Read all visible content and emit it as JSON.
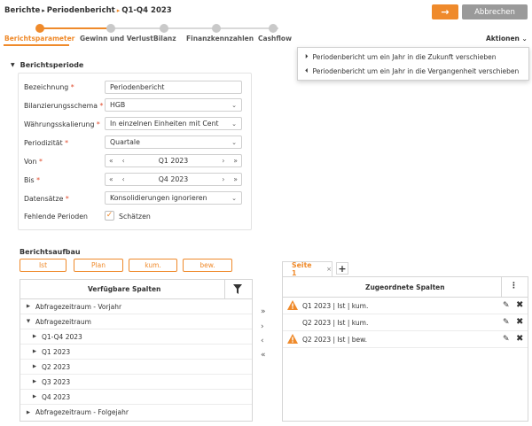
{
  "breadcrumb": {
    "items": [
      "Berichte",
      "Periodenbericht",
      "Q1-Q4 2023"
    ]
  },
  "header_buttons": {
    "next_label": "→",
    "cancel_label": "Abbrechen"
  },
  "steps": [
    {
      "label": "Berichtsparameter",
      "active": true
    },
    {
      "label": "Gewinn und Verlust",
      "active": false
    },
    {
      "label": "Bilanz",
      "active": false
    },
    {
      "label": "Finanzkennzahlen",
      "active": false
    },
    {
      "label": "Cashflow",
      "active": false
    }
  ],
  "actions": {
    "label": "Aktionen",
    "chevron": "⌄"
  },
  "dropdown": {
    "items": [
      {
        "icon": "skip-forward-icon",
        "glyph": "⏵",
        "label": "Periodenbericht um ein Jahr in die Zukunft verschieben"
      },
      {
        "icon": "skip-back-icon",
        "glyph": "⏴",
        "label": "Periodenbericht um ein Jahr in die Vergangenheit verschieben"
      }
    ]
  },
  "berichtsperiode": {
    "title": "Berichtsperiode",
    "fields": {
      "bezeichnung": {
        "label": "Bezeichnung",
        "required": "*",
        "value": "Periodenbericht"
      },
      "schema": {
        "label": "Bilanzierungsschema",
        "required": "*",
        "value": "HGB"
      },
      "skalierung": {
        "label": "Währungsskalierung",
        "required": "*",
        "value": "In einzelnen Einheiten mit Cent"
      },
      "periodizitaet": {
        "label": "Periodizität",
        "required": "*",
        "value": "Quartale"
      },
      "von": {
        "label": "Von",
        "required": "*",
        "value": "Q1 2023"
      },
      "bis": {
        "label": "Bis",
        "required": "*",
        "value": "Q4 2023"
      },
      "datensaetze": {
        "label": "Datensätze",
        "required": "*",
        "value": "Konsolidierungen ignorieren"
      },
      "fehlende": {
        "label": "Fehlende Perioden",
        "checkbox_label": "Schätzen",
        "checked": true
      }
    },
    "nav": {
      "first": "«",
      "prev": "‹",
      "next": "›",
      "last": "»"
    }
  },
  "berichtsaufbau": {
    "title": "Berichtsaufbau",
    "buttons": [
      "Ist",
      "Plan",
      "kum.",
      "bew."
    ]
  },
  "verfuegbar": {
    "title": "Verfügbare Spalten",
    "rows": [
      {
        "label": "Abfragezeitraum - Vorjahr",
        "toggle": "▶",
        "level": 0
      },
      {
        "label": "Abfragezeitraum",
        "toggle": "▼",
        "level": 0
      },
      {
        "label": "Q1-Q4 2023",
        "toggle": "▶",
        "level": 1
      },
      {
        "label": "Q1 2023",
        "toggle": "▶",
        "level": 1
      },
      {
        "label": "Q2 2023",
        "toggle": "▶",
        "level": 1
      },
      {
        "label": "Q3 2023",
        "toggle": "▶",
        "level": 1
      },
      {
        "label": "Q4 2023",
        "toggle": "▶",
        "level": 1
      },
      {
        "label": "Abfragezeitraum - Folgejahr",
        "toggle": "▶",
        "level": 0
      }
    ]
  },
  "transfer": {
    "all_right": "»",
    "right": "›",
    "left": "‹",
    "all_left": "«"
  },
  "tabs": {
    "tab1_label": "Seite 1",
    "tab1_close": "×",
    "add": "+"
  },
  "zugeordnet": {
    "title": "Zugeordnete Spalten",
    "menu": "⋮",
    "rows": [
      {
        "label": "Q1 2023 | Ist | kum.",
        "warning": true
      },
      {
        "label": "Q2 2023 | Ist | kum.",
        "warning": false
      },
      {
        "label": "Q2 2023 | Ist | bew.",
        "warning": true
      }
    ],
    "edit_glyph": "✎",
    "delete_glyph": "✖"
  },
  "colors": {
    "accent": "#ef8a2b",
    "cancel": "#9a9a9a",
    "required": "#e04a2b",
    "warning": "#ef8a2b"
  }
}
